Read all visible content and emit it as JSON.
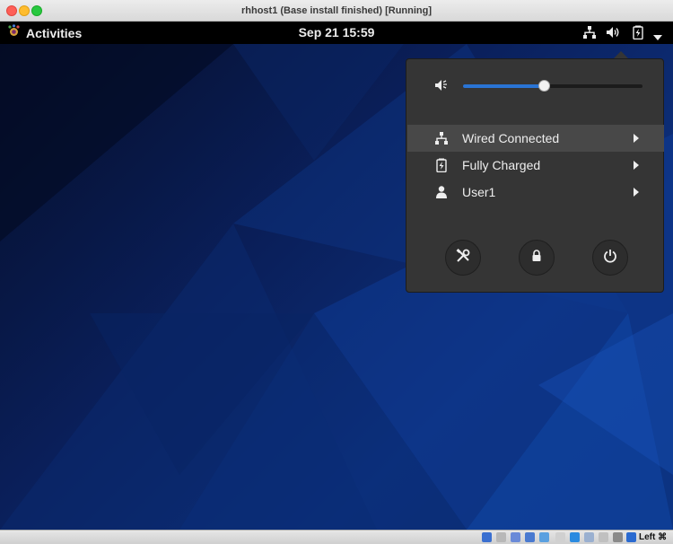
{
  "window": {
    "title": "rhhost1 (Base install finished) [Running]"
  },
  "topbar": {
    "activities_label": "Activities",
    "clock": "Sep 21  15:59",
    "tray_icons": [
      "network-wired-icon",
      "volume-icon",
      "battery-charged-icon",
      "dropdown-arrow-icon"
    ]
  },
  "system_menu": {
    "volume": {
      "icon": "volume-muted-icon",
      "level_fraction": 0.45
    },
    "items": [
      {
        "label": "Wired Connected",
        "icon": "network-wired-icon",
        "highlighted": true
      },
      {
        "label": "Fully Charged",
        "icon": "battery-charged-icon",
        "highlighted": false
      },
      {
        "label": "User1",
        "icon": "user-icon",
        "highlighted": false
      }
    ],
    "buttons": [
      {
        "name": "settings",
        "icon": "settings-tools-icon"
      },
      {
        "name": "lock",
        "icon": "lock-icon"
      },
      {
        "name": "power",
        "icon": "power-icon"
      }
    ]
  },
  "statusbar": {
    "host_key_label": "Left ⌘"
  },
  "colors": {
    "accent": "#2a74d4",
    "menu_bg": "#353535",
    "topbar_bg": "#000000"
  }
}
